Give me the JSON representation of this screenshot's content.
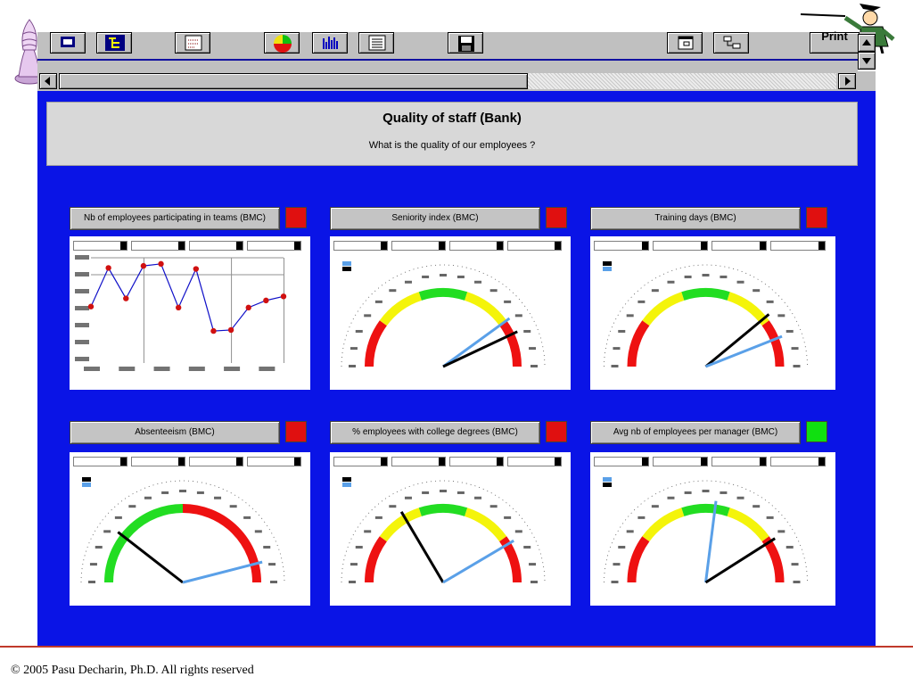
{
  "toolbar": {
    "print_label": "Print"
  },
  "header": {
    "title": "Quality of staff (Bank)",
    "subtitle": "What is the quality of our employees ?"
  },
  "kpis": [
    {
      "label": "Nb of employees participating in teams (BMC)",
      "status_color": "#e01010"
    },
    {
      "label": "Seniority index (BMC)",
      "status_color": "#e01010"
    },
    {
      "label": "Training days (BMC)",
      "status_color": "#e01010"
    },
    {
      "label": "Absenteeism (BMC)",
      "status_color": "#e01010"
    },
    {
      "label": "% employees with college degrees (BMC)",
      "status_color": "#e01010"
    },
    {
      "label": "Avg nb of employees per manager (BMC)",
      "status_color": "#10e010"
    }
  ],
  "chart_data": [
    {
      "type": "line",
      "series": [
        {
          "values": [
            52,
            90,
            60,
            92,
            94,
            51,
            89,
            28,
            29,
            51,
            58,
            62
          ]
        }
      ],
      "ylim": [
        0,
        100
      ],
      "grid": true
    },
    {
      "type": "gauge",
      "zones": [
        "red",
        "yellow",
        "green",
        "yellow",
        "red"
      ],
      "pointers": [
        {
          "color": "#5aa0e8",
          "value": 0.8
        },
        {
          "color": "#000000",
          "value": 0.86
        }
      ]
    },
    {
      "type": "gauge",
      "zones": [
        "red",
        "yellow",
        "green",
        "yellow",
        "red"
      ],
      "pointers": [
        {
          "color": "#000000",
          "value": 0.78
        },
        {
          "color": "#5aa0e8",
          "value": 0.88
        }
      ]
    },
    {
      "type": "gauge",
      "zones": [
        "green",
        "red"
      ],
      "pointers": [
        {
          "color": "#000000",
          "value": 0.21
        },
        {
          "color": "#5aa0e8",
          "value": 0.92
        }
      ]
    },
    {
      "type": "gauge",
      "zones": [
        "red",
        "yellow",
        "green",
        "yellow",
        "red"
      ],
      "pointers": [
        {
          "color": "#000000",
          "value": 0.33
        },
        {
          "color": "#5aa0e8",
          "value": 0.83
        }
      ]
    },
    {
      "type": "gauge",
      "zones": [
        "red",
        "yellow",
        "green",
        "yellow",
        "red"
      ],
      "pointers": [
        {
          "color": "#5aa0e8",
          "value": 0.54
        },
        {
          "color": "#000000",
          "value": 0.82
        }
      ]
    }
  ],
  "colors": {
    "canvas": "#0a14e6",
    "gauge_red": "#ee1111",
    "gauge_yellow": "#f4f40a",
    "gauge_green": "#22dd22",
    "line": "#1010c8",
    "marker": "#d01010"
  },
  "icons": [
    "chart-toggle-icon",
    "hierarchy-icon",
    "dotted-list-icon",
    "pie-chart-icon",
    "bar-chart-icon",
    "table-icon",
    "save-disk-icon",
    "window-icon",
    "tree-icon"
  ],
  "footer": {
    "copyright": "© 2005 Pasu Decharin, Ph.D. All rights reserved"
  }
}
